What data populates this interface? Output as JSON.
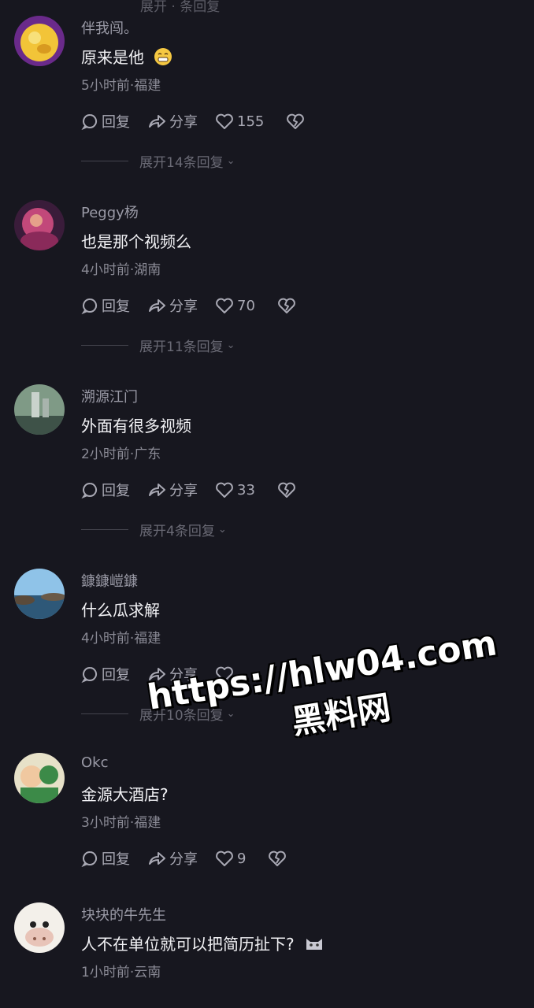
{
  "top_cut_text": "展开 · 条回复",
  "action_labels": {
    "reply": "回复",
    "share": "分享"
  },
  "comments": [
    {
      "username": "伴我闯。",
      "text": "原来是他",
      "meta": "5小时前·福建",
      "likes": "155",
      "expand": "展开14条回复",
      "avatar_colors": [
        "#f2c438",
        "#6a2a8a"
      ],
      "emoji": "grin-icon"
    },
    {
      "username": "Peggy杨",
      "text": "也是那个视频么",
      "meta": "4小时前·湖南",
      "likes": "70",
      "expand": "展开11条回复",
      "avatar_colors": [
        "#c2487a",
        "#3a1c3a"
      ]
    },
    {
      "username": "溯源江门",
      "text": "外面有很多视频",
      "meta": "2小时前·广东",
      "likes": "33",
      "expand": "展开4条回复",
      "avatar_colors": [
        "#7f9a86",
        "#3e5248"
      ]
    },
    {
      "username": "鏮鏮嵦鏮",
      "text": "什么瓜求解",
      "meta": "4小时前·福建",
      "likes": "",
      "expand": "展开10条回复",
      "avatar_colors": [
        "#8fc3e8",
        "#2e5878"
      ]
    },
    {
      "username": "Okc",
      "text": "金源大酒店?",
      "meta": "3小时前·福建",
      "likes": "9",
      "expand": "",
      "avatar_colors": [
        "#e7e1c8",
        "#3c8a48"
      ]
    },
    {
      "username": "块块的牛先生",
      "text": "人不在单位就可以把简历扯下?",
      "meta": "1小时前·云南",
      "likes": "",
      "expand": "",
      "avatar_colors": [
        "#f3f0ea",
        "#c49a7a"
      ],
      "emoji": "cat-icon"
    }
  ],
  "watermark": {
    "url": "https://hlw04.com",
    "site": "黑料网"
  }
}
